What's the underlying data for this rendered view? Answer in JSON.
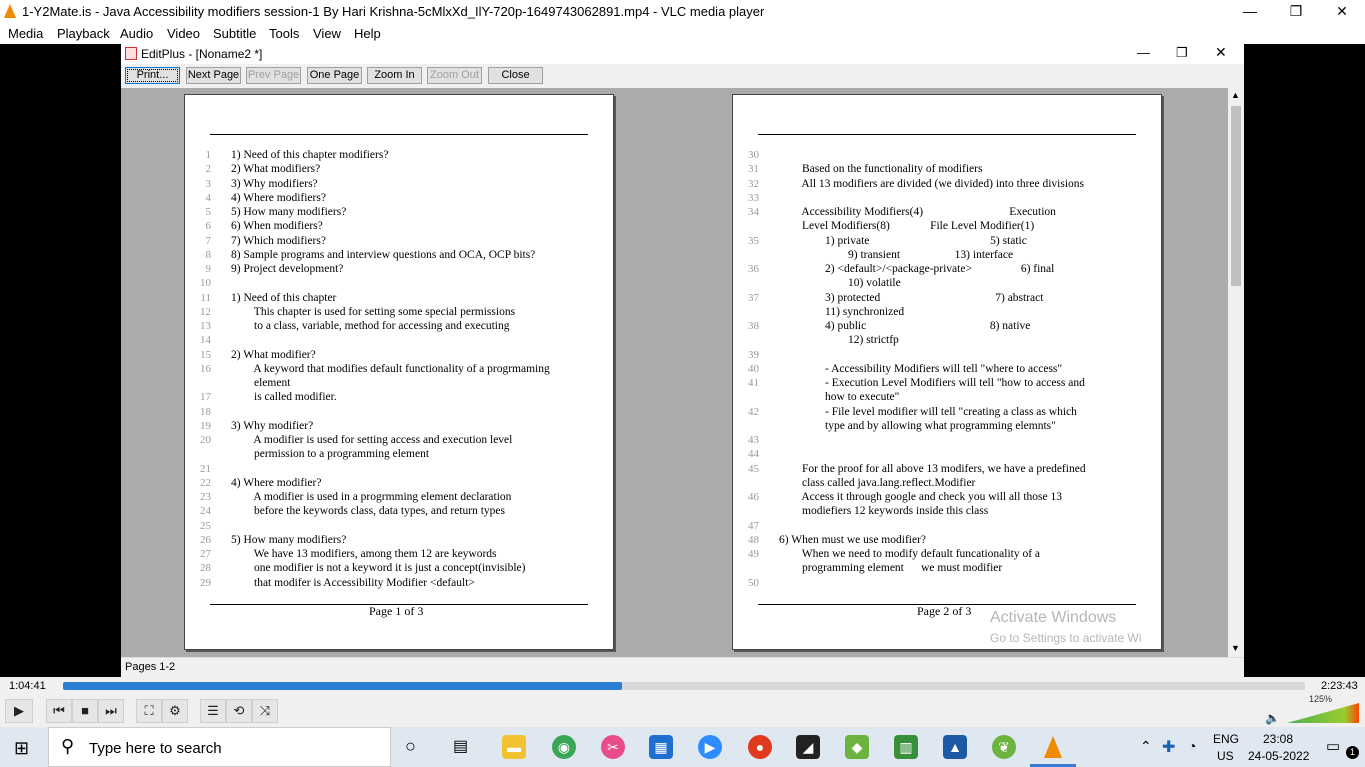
{
  "window": {
    "title": "1-Y2Mate.is - Java Accessibility modifiers session-1  By Hari Krishna-5cMlxXd_IlY-720p-1649743062891.mp4 - VLC media player",
    "min": "—",
    "max": "❐",
    "close": "✕"
  },
  "menu": [
    "Media",
    "Playback",
    "Audio",
    "Video",
    "Subtitle",
    "Tools",
    "View",
    "Help"
  ],
  "editplus": {
    "title": "EditPlus - [Noname2 *]",
    "toolbar": [
      "Print...",
      "Next Page",
      "Prev Page",
      "One Page",
      "Zoom In",
      "Zoom Out",
      "Close"
    ],
    "status": "Pages 1-2",
    "page1": {
      "lines": [
        {
          "n": "1",
          "t": "1) Need of this chapter modifiers?"
        },
        {
          "n": "2",
          "t": "2) What modifiers?"
        },
        {
          "n": "3",
          "t": "3) Why modifiers?"
        },
        {
          "n": "4",
          "t": "4) Where modifiers?"
        },
        {
          "n": "5",
          "t": "5) How many modifiers?"
        },
        {
          "n": "6",
          "t": "6) When modifiers?"
        },
        {
          "n": "7",
          "t": "7) Which modifiers?"
        },
        {
          "n": "8",
          "t": "8) Sample programs and interview questions and OCA, OCP bits?"
        },
        {
          "n": "9",
          "t": "9) Project development?"
        },
        {
          "n": "10",
          "t": ""
        },
        {
          "n": "11",
          "t": "1) Need of this chapter"
        },
        {
          "n": "12",
          "t": "        This chapter is used for setting some special permissions"
        },
        {
          "n": "13",
          "t": "        to a class, variable, method for accessing and executing"
        },
        {
          "n": "14",
          "t": ""
        },
        {
          "n": "15",
          "t": "2) What modifier?"
        },
        {
          "n": "16",
          "t": "        A keyword that modifies default functionality of a progrmaming"
        },
        {
          "n": "",
          "t": "        element"
        },
        {
          "n": "17",
          "t": "        is called modifier."
        },
        {
          "n": "18",
          "t": ""
        },
        {
          "n": "19",
          "t": "3) Why modifier?"
        },
        {
          "n": "20",
          "t": "        A modifier is used for setting access and execution level"
        },
        {
          "n": "",
          "t": "        permission to a programming element"
        },
        {
          "n": "21",
          "t": ""
        },
        {
          "n": "22",
          "t": "4) Where modifier?"
        },
        {
          "n": "23",
          "t": "        A modifier is used in a progrmming element declaration"
        },
        {
          "n": "24",
          "t": "        before the keywords class, data types, and return types"
        },
        {
          "n": "25",
          "t": ""
        },
        {
          "n": "26",
          "t": "5) How many modifiers?"
        },
        {
          "n": "27",
          "t": "        We have 13 modifiers, among them 12 are keywords"
        },
        {
          "n": "28",
          "t": "        one modifier is not a keyword it is just a concept(invisible)"
        },
        {
          "n": "29",
          "t": "        that modifer is Accessibility Modifier <default>"
        }
      ],
      "footer": "Page 1 of 3"
    },
    "page2": {
      "lines": [
        {
          "n": "30",
          "t": ""
        },
        {
          "n": "31",
          "t": "        Based on the functionality of modifiers"
        },
        {
          "n": "32",
          "t": "        All 13 modifiers are divided (we divided) into three divisions"
        },
        {
          "n": "33",
          "t": ""
        },
        {
          "n": "34",
          "t": "        Accessibility Modifiers(4)                              Execution"
        },
        {
          "n": "",
          "t": "        Level Modifiers(8)              File Level Modifier(1)"
        },
        {
          "n": "35",
          "t": "                1) private                                          5) static"
        },
        {
          "n": "",
          "t": "                        9) transient                   13) interface"
        },
        {
          "n": "36",
          "t": "                2) <default>/<package-private>                 6) final"
        },
        {
          "n": "",
          "t": "                        10) volatile"
        },
        {
          "n": "37",
          "t": "                3) protected                                        7) abstract"
        },
        {
          "n": "",
          "t": "                11) synchronized"
        },
        {
          "n": "38",
          "t": "                4) public                                           8) native"
        },
        {
          "n": "",
          "t": "                        12) strictfp"
        },
        {
          "n": "39",
          "t": ""
        },
        {
          "n": "40",
          "t": "                - Accessibility Modifiers will tell \"where to access\""
        },
        {
          "n": "41",
          "t": "                - Execution Level Modifiers will tell \"how to access and"
        },
        {
          "n": "",
          "t": "                how to execute\""
        },
        {
          "n": "42",
          "t": "                - File level modifier will tell \"creating a class as which"
        },
        {
          "n": "",
          "t": "                type and by allowing what programming elemnts\""
        },
        {
          "n": "43",
          "t": ""
        },
        {
          "n": "44",
          "t": ""
        },
        {
          "n": "45",
          "t": "        For the proof for all above 13 modifers, we have a predefined"
        },
        {
          "n": "",
          "t": "        class called java.lang.reflect.Modifier"
        },
        {
          "n": "46",
          "t": "        Access it through google and check you will all those 13"
        },
        {
          "n": "",
          "t": "        modiefiers 12 keywords inside this class"
        },
        {
          "n": "47",
          "t": ""
        },
        {
          "n": "48",
          "t": "6) When must we use modifier?"
        },
        {
          "n": "49",
          "t": "        When we need to modify default funcationality of a"
        },
        {
          "n": "",
          "t": "        programming element      we must modifier"
        },
        {
          "n": "50",
          "t": ""
        }
      ],
      "footer": "Page 2 of 3"
    }
  },
  "watermark": {
    "line1": "Activate Windows",
    "line2": "Go to Settings to activate Wi"
  },
  "player": {
    "elapsed": "1:04:41",
    "total": "2:23:43",
    "progress": 0.45,
    "volume": "125%"
  },
  "taskbar": {
    "search_placeholder": "Type here to search",
    "lang": "ENG",
    "region": "US",
    "time": "23:08",
    "date": "24-05-2022",
    "notif": "1"
  }
}
